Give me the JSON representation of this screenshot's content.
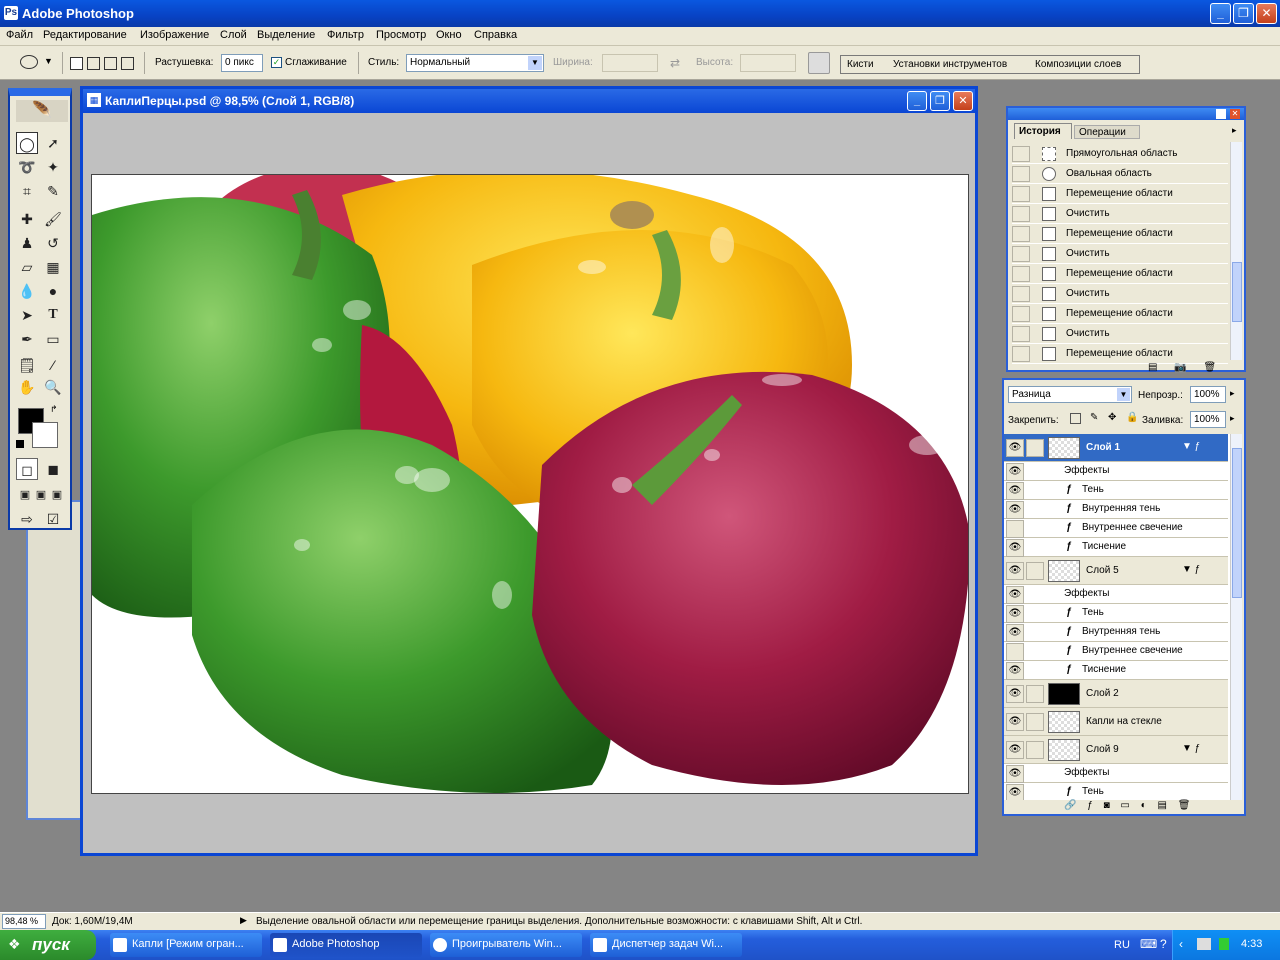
{
  "app": {
    "title": "Adobe Photoshop"
  },
  "menu": [
    "Файл",
    "Редактирование",
    "Изображение",
    "Слой",
    "Выделение",
    "Фильтр",
    "Просмотр",
    "Окно",
    "Справка"
  ],
  "options": {
    "feather_label": "Растушевка:",
    "feather_value": "0 пикс",
    "antialias_label": "Сглаживание",
    "style_label": "Стиль:",
    "style_value": "Нормальный",
    "width_label": "Ширина:",
    "height_label": "Высота:"
  },
  "wells": [
    "Кисти",
    "Установки инструментов",
    "Композиции слоев"
  ],
  "document": {
    "title": "КаплиПерцы.psd @ 98,5% (Слой 1, RGB/8)"
  },
  "history": {
    "tabs": [
      "История",
      "Операции"
    ],
    "items": [
      "Прямоугольная область",
      "Овальная область",
      "Перемещение области",
      "Очистить",
      "Перемещение области",
      "Очистить",
      "Перемещение области",
      "Очистить",
      "Перемещение области",
      "Очистить",
      "Перемещение области"
    ]
  },
  "layers": {
    "blend_mode": "Разница",
    "opacity_label": "Непрозр.:",
    "opacity_value": "100%",
    "lock_label": "Закрепить:",
    "fill_label": "Заливка:",
    "fill_value": "100%",
    "rows": [
      {
        "name": "Слой 1",
        "type": "layer",
        "selected": true
      },
      {
        "name": "Эффекты",
        "type": "effects"
      },
      {
        "name": "Тень",
        "type": "fx"
      },
      {
        "name": "Внутренняя тень",
        "type": "fx"
      },
      {
        "name": "Внутреннее свечение",
        "type": "fx"
      },
      {
        "name": "Тиснение",
        "type": "fx"
      },
      {
        "name": "Слой 5",
        "type": "layer"
      },
      {
        "name": "Эффекты",
        "type": "effects"
      },
      {
        "name": "Тень",
        "type": "fx"
      },
      {
        "name": "Внутренняя тень",
        "type": "fx"
      },
      {
        "name": "Внутреннее свечение",
        "type": "fx"
      },
      {
        "name": "Тиснение",
        "type": "fx"
      },
      {
        "name": "Слой 2",
        "type": "layer",
        "black": true
      },
      {
        "name": "Капли  на стекле",
        "type": "layer"
      },
      {
        "name": "Слой 9",
        "type": "layer"
      },
      {
        "name": "Эффекты",
        "type": "effects"
      },
      {
        "name": "Тень",
        "type": "fx"
      }
    ]
  },
  "status": {
    "zoom": "98,48 %",
    "doc": "Док: 1,60M/19,4M",
    "hint": "Выделение овальной области или перемещение границы выделения. Дополнительные возможности: с клавишами Shift, Alt и Ctrl."
  },
  "taskbar": {
    "start": "пуск",
    "buttons": [
      "Капли [Режим огран...",
      "Adobe Photoshop",
      "Проигрыватель Win...",
      "Диспетчер задач Wi..."
    ],
    "lang": "RU",
    "clock": "4:33"
  }
}
